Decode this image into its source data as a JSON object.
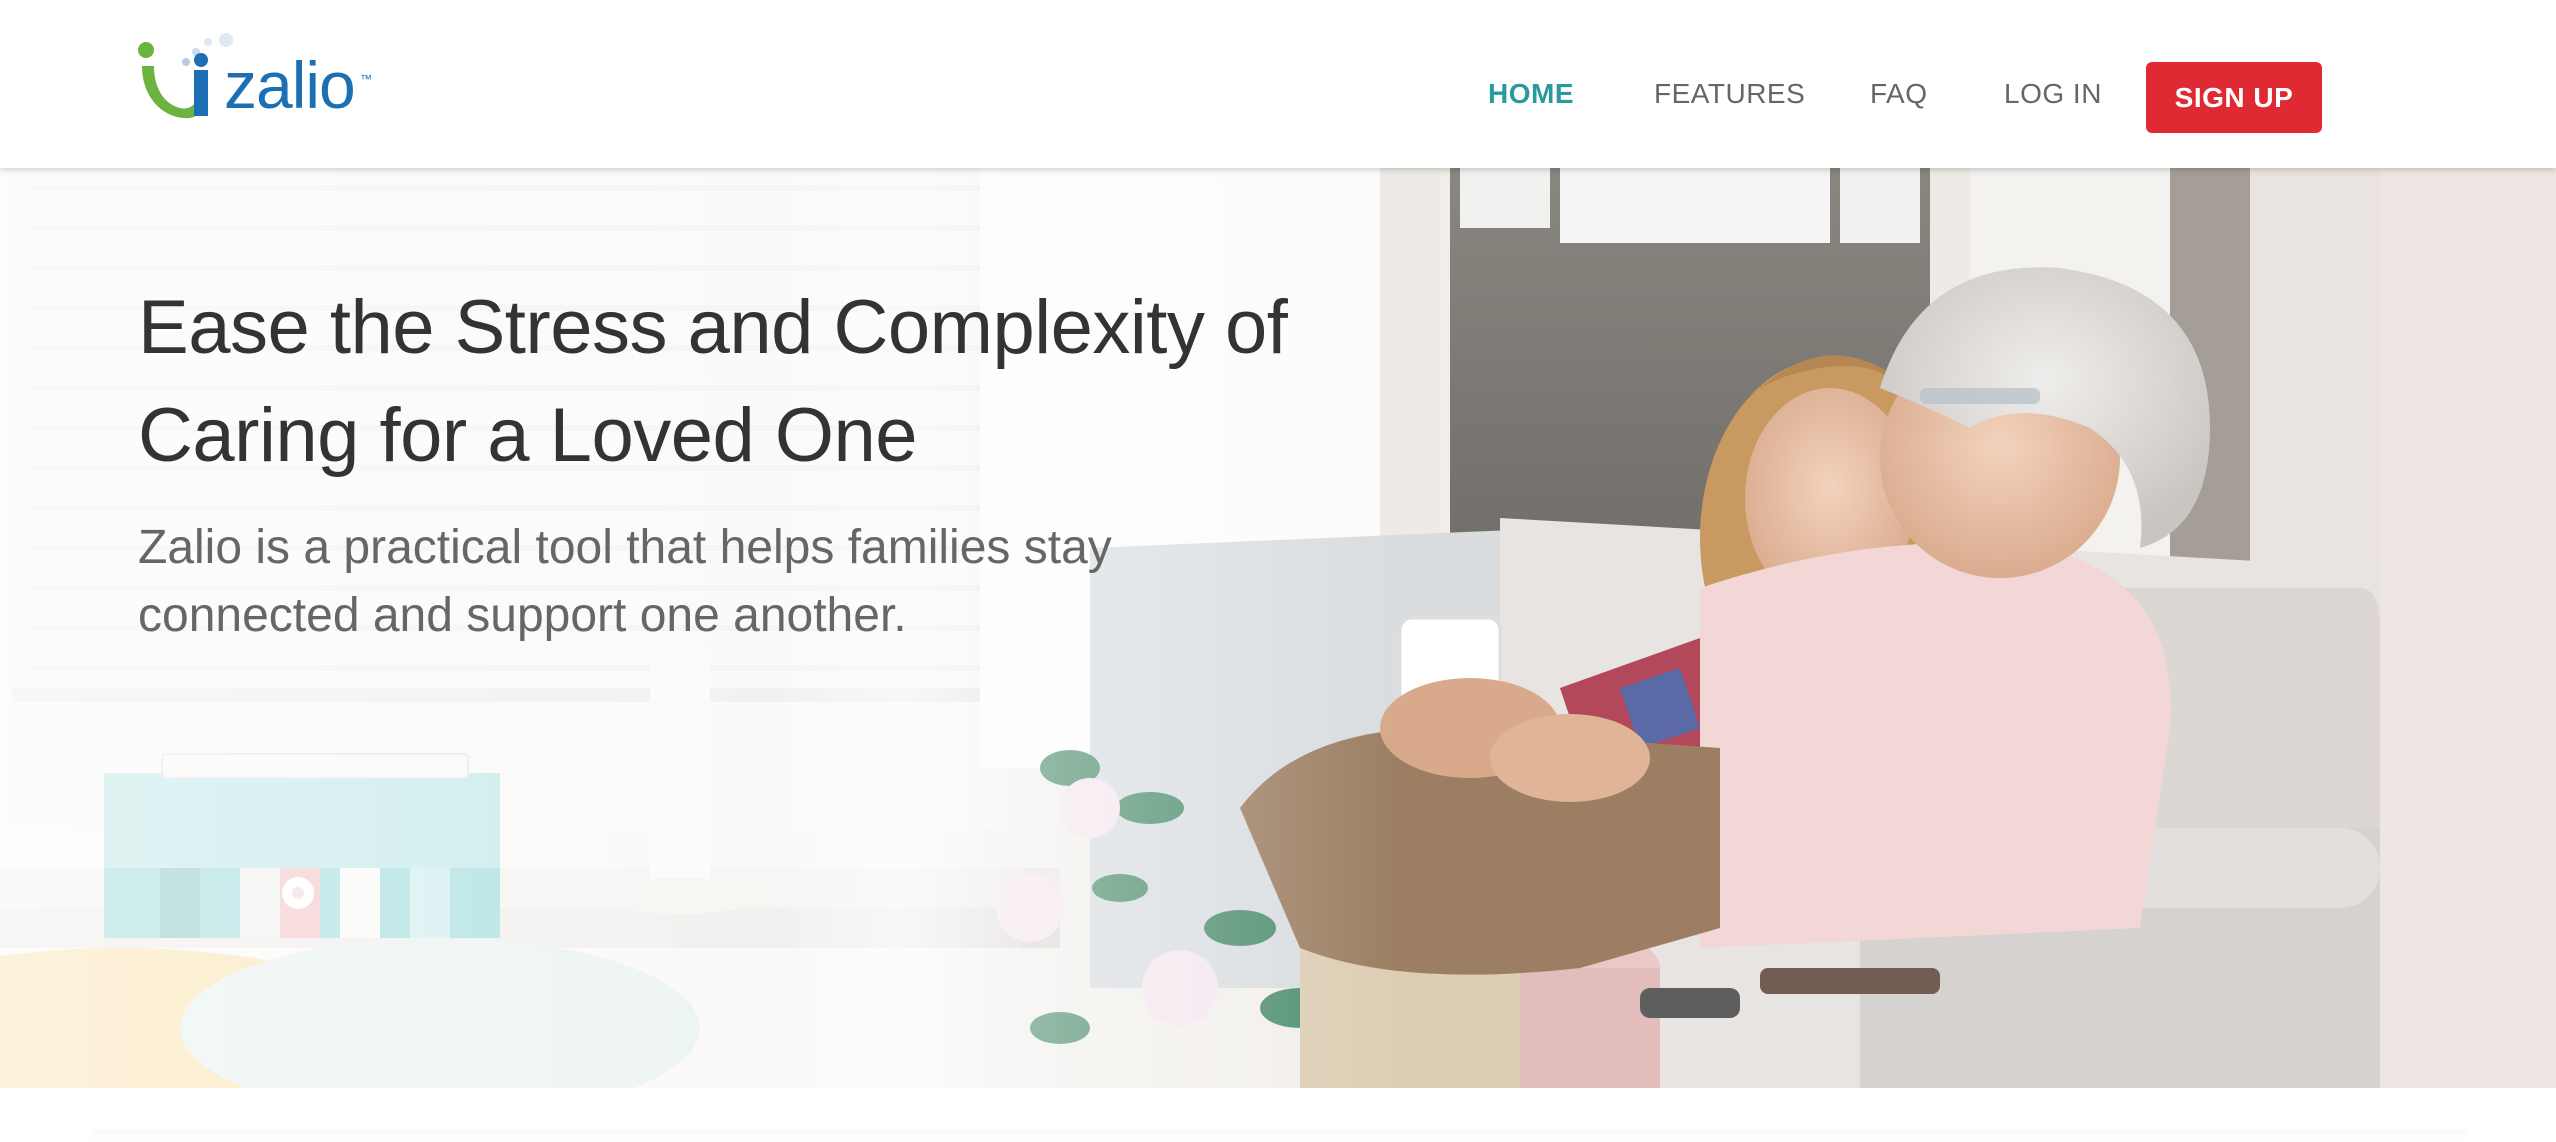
{
  "header": {
    "logo_text": "zalio",
    "logo_tm": "™",
    "nav": {
      "home": "HOME",
      "features": "FEATURES",
      "faq": "FAQ",
      "login": "LOG IN",
      "signup": "SIGN UP"
    }
  },
  "hero": {
    "headline": "Ease the Stress and Complexity of Caring for a Loved One",
    "subhead": "Zalio is a practical tool that helps families stay connected and support one another."
  },
  "colors": {
    "brand_blue": "#1d6fb3",
    "brand_green": "#6db33f",
    "nav_active": "#2b9a9f",
    "signup_red": "#df2a34",
    "text_dark": "#333333",
    "text_muted": "#666666"
  },
  "icons": {
    "logo": "zalio-logo-icon"
  }
}
